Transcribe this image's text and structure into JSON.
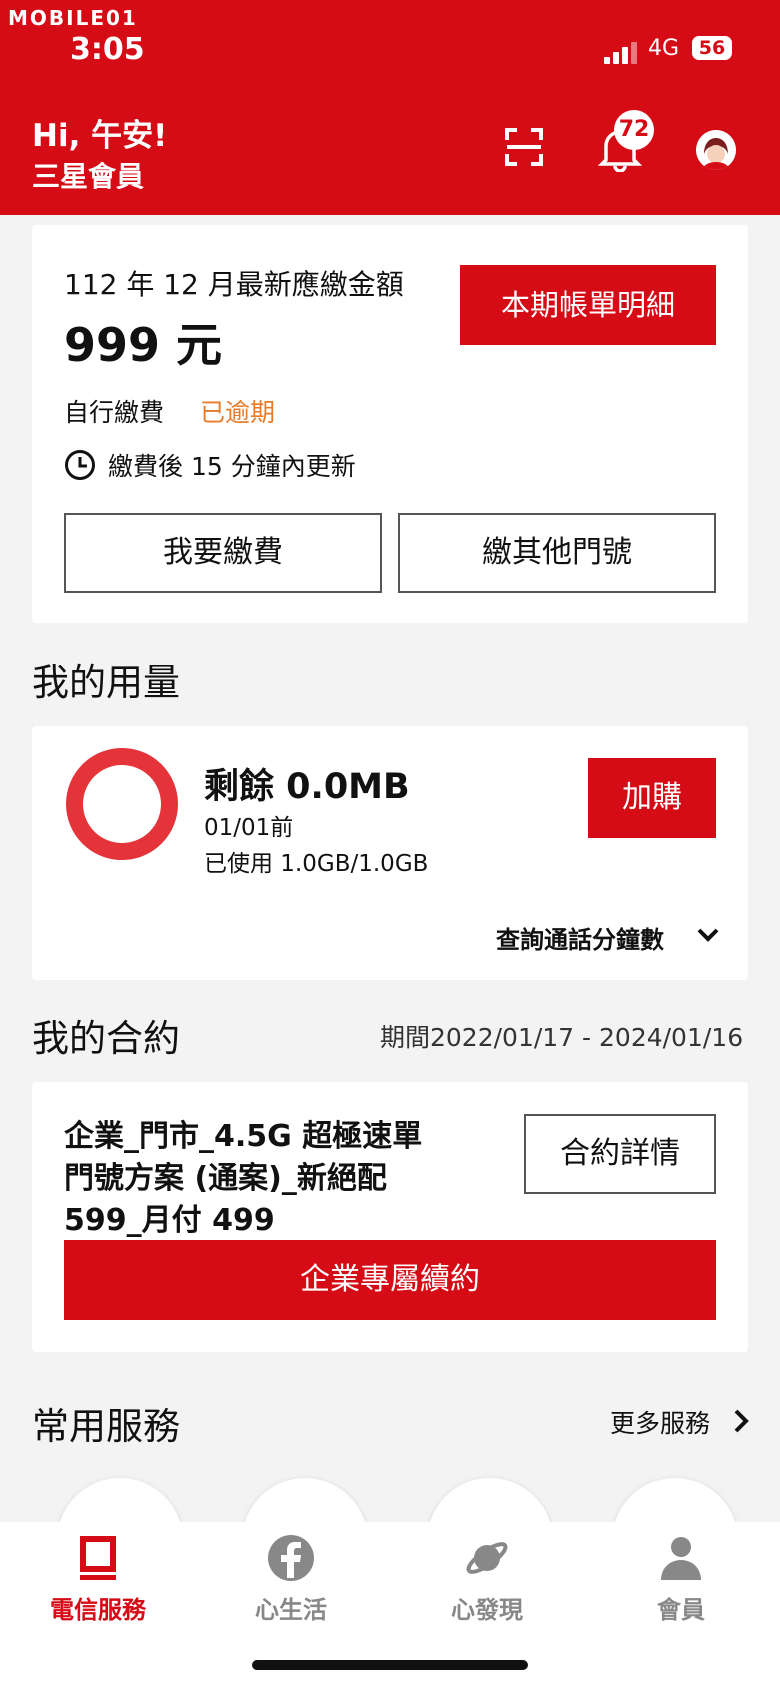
{
  "status_bar": {
    "watermark": "MOBILE01",
    "time": "3:05",
    "network": "4G",
    "battery": "56"
  },
  "header": {
    "greeting": "Hi, 午安!",
    "member": "三星會員",
    "notification_count": "72"
  },
  "bill": {
    "title": "112 年 12 月最新應繳金額",
    "amount": "999 元",
    "detail_button": "本期帳單明細",
    "pay_method": "自行繳費",
    "status": "已逾期",
    "update_note": "繳費後 15 分鐘內更新",
    "pay_button": "我要繳費",
    "other_button": "繳其他門號"
  },
  "usage": {
    "section_title": "我的用量",
    "remaining": "剩餘 0.0MB",
    "before": "01/01前",
    "used": "已使用 1.0GB/1.0GB",
    "remaining_fraction": 0,
    "add_button": "加購",
    "query_minutes": "查詢通話分鐘數"
  },
  "contract": {
    "section_title": "我的合約",
    "period": "期間2022/01/17 - 2024/01/16",
    "plan_line1": "企業_門市_4.5G 超極速單",
    "plan_line2": "門號方案 (通案)_新絕配",
    "plan_line3": " 599_月付 499",
    "detail_button": "合約詳情",
    "renew_button": "企業專屬續約"
  },
  "services": {
    "section_title": "常用服務",
    "more_link": "更多服務"
  },
  "tabbar": {
    "tabs": [
      {
        "label": "電信服務",
        "icon": "telecom-icon",
        "active": true
      },
      {
        "label": "心生活",
        "icon": "facebook-icon",
        "active": false
      },
      {
        "label": "心發現",
        "icon": "planet-icon",
        "active": false
      },
      {
        "label": "會員",
        "icon": "person-icon",
        "active": false
      }
    ]
  },
  "colors": {
    "brand_red": "#d50b15",
    "overdue_orange": "#e87b27",
    "ring_red": "#e5333a",
    "inactive_gray": "#888888"
  }
}
